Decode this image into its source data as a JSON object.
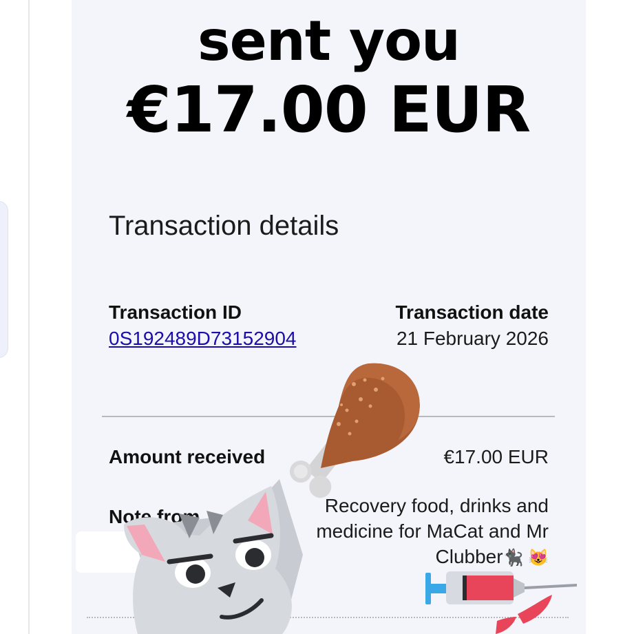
{
  "email": {
    "headline_line1": "sent you",
    "headline_line2": "€17.00 EUR",
    "section_title": "Transaction details",
    "transaction_id_label": "Transaction ID",
    "transaction_id_value": "0S192489D73152904",
    "transaction_date_label": "Transaction date",
    "transaction_date_value": "21 February 2026",
    "amount_label": "Amount received",
    "amount_value": "€17.00 EUR",
    "note_label": "Note from",
    "note_text": "Recovery food, drinks and medicine for MaCat and Mr Clubber",
    "note_emojis": "🐈‍⬛ 😻"
  },
  "stickers": [
    "drumstick-sticker",
    "cat-sticker",
    "syringe-sticker"
  ],
  "colors": {
    "link": "#1a0dab",
    "panel_bg": "#f4f5fa",
    "drumstick": "#a0522d",
    "syringe_fill": "#e8445a"
  }
}
